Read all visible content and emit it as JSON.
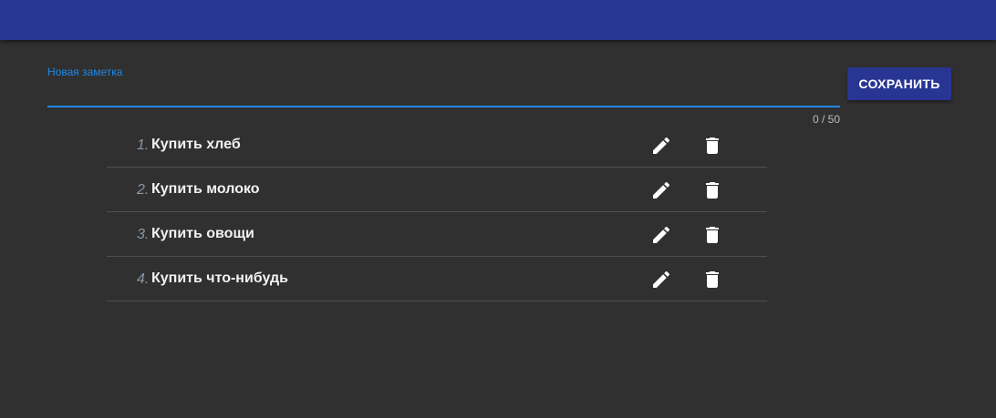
{
  "app_bar": {
    "color": "#283593"
  },
  "note_input": {
    "label": "Новая заметка",
    "value": "",
    "placeholder": "",
    "counter": "0 / 50",
    "accent_color": "#1e88e5"
  },
  "save_button": {
    "label": "СОХРАНИТЬ"
  },
  "notes": [
    {
      "index": "1.",
      "text": "Купить хлеб",
      "edit_icon": "pencil-icon",
      "delete_icon": "trash-icon"
    },
    {
      "index": "2.",
      "text": "Купить молоко",
      "edit_icon": "pencil-icon",
      "delete_icon": "trash-icon"
    },
    {
      "index": "3.",
      "text": "Купить овощи",
      "edit_icon": "pencil-icon",
      "delete_icon": "trash-icon"
    },
    {
      "index": "4.",
      "text": "Купить что-нибудь",
      "edit_icon": "pencil-icon",
      "delete_icon": "trash-icon"
    }
  ]
}
